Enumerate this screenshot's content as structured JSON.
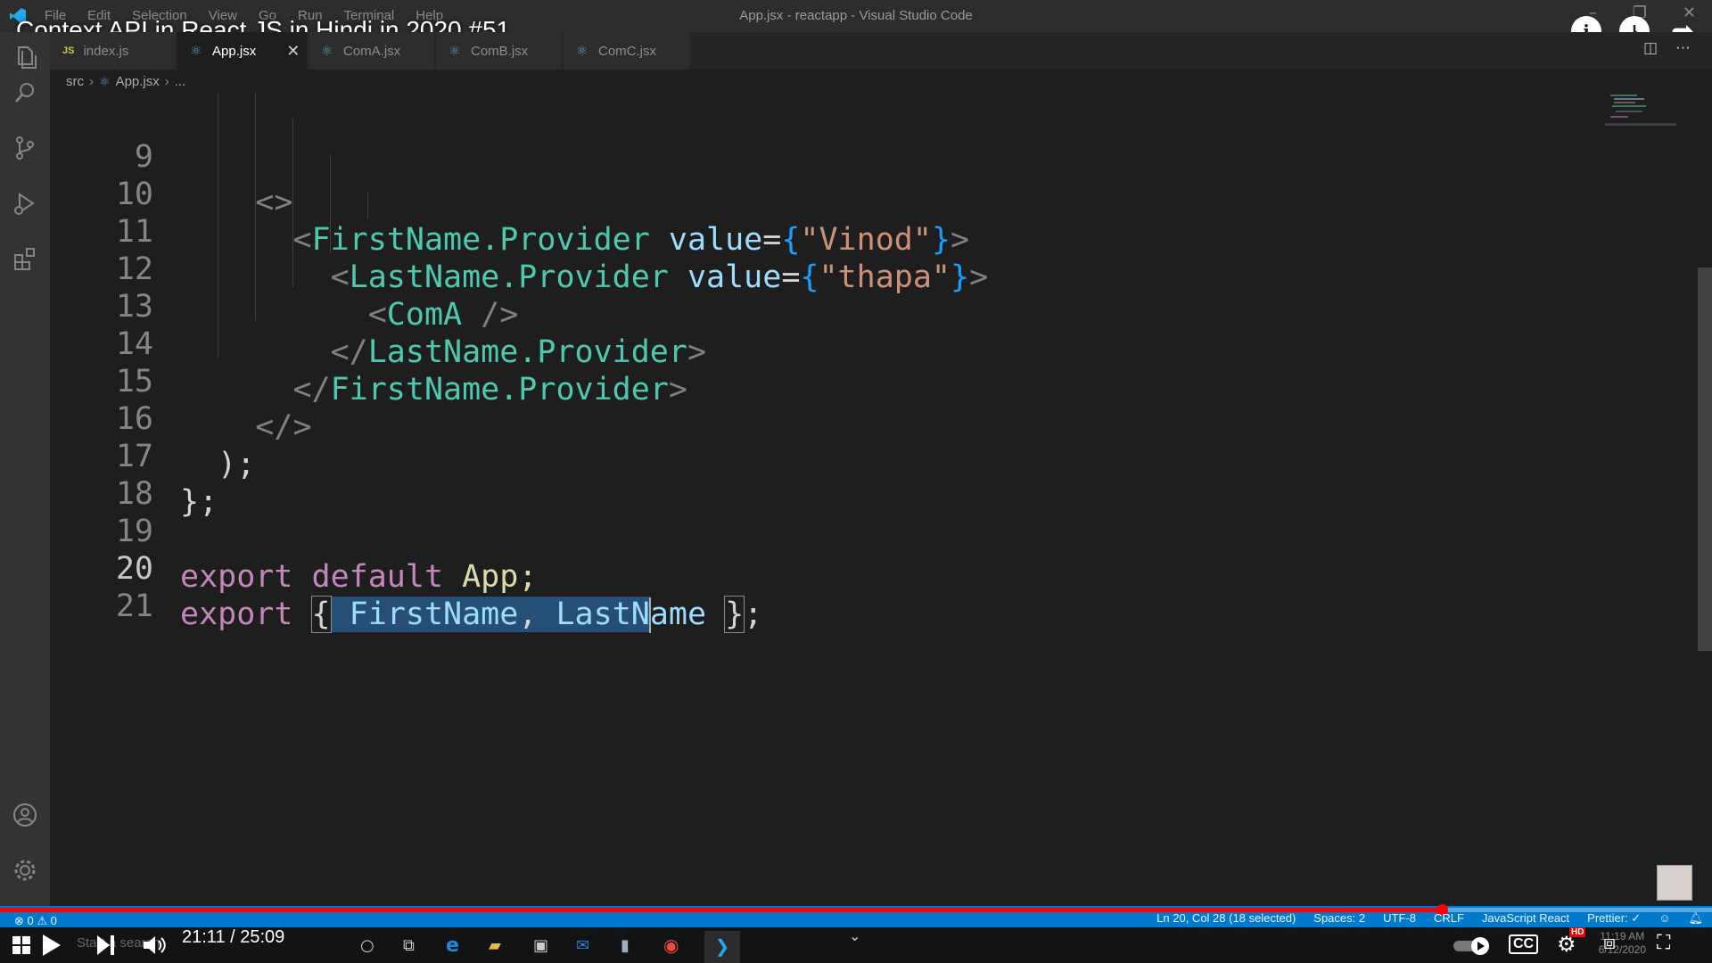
{
  "window": {
    "title": "App.jsx - reactapp - Visual Studio Code",
    "menu": [
      "File",
      "Edit",
      "Selection",
      "View",
      "Go",
      "Run",
      "Terminal",
      "Help"
    ]
  },
  "video": {
    "title": "Context API in React JS in Hindi in 2020 #51",
    "time": "21:11 / 25:09",
    "progress": 0.842,
    "quality_badge": "HD"
  },
  "tabs": [
    {
      "label": "index.js",
      "icon": "JS",
      "active": false
    },
    {
      "label": "App.jsx",
      "icon": "react-icon",
      "active": true
    },
    {
      "label": "ComA.jsx",
      "icon": "react-icon",
      "active": false
    },
    {
      "label": "ComB.jsx",
      "icon": "react-icon",
      "active": false
    },
    {
      "label": "ComC.jsx",
      "icon": "react-icon",
      "active": false
    }
  ],
  "breadcrumb": {
    "folder": "src",
    "file": "App.jsx",
    "more": "..."
  },
  "code": {
    "lines": [
      {
        "num": "9",
        "text": "      <>"
      },
      {
        "num": "10",
        "text": "        <FirstName.Provider value={\"Vinod\"}>"
      },
      {
        "num": "11",
        "text": "          <LastName.Provider value={\"thapa\"}>"
      },
      {
        "num": "12",
        "text": "            <ComA />"
      },
      {
        "num": "13",
        "text": "          </LastName.Provider>"
      },
      {
        "num": "14",
        "text": "        </FirstName.Provider>"
      },
      {
        "num": "15",
        "text": "      </>"
      },
      {
        "num": "16",
        "text": "    );"
      },
      {
        "num": "17",
        "text": "};"
      },
      {
        "num": "18",
        "text": ""
      },
      {
        "num": "19",
        "text": "export default App;"
      },
      {
        "num": "20",
        "text": "export { FirstName, LastName };"
      },
      {
        "num": "21",
        "text": ""
      }
    ],
    "tokens": {
      "open_frag": "<>",
      "close_frag": "</>",
      "first_provider": "FirstName.Provider",
      "last_provider": "LastName.Provider",
      "value_attr": "value",
      "vinod": "\"Vinod\"",
      "thapa": "\"thapa\"",
      "coma": "ComA",
      "paren_close": ");",
      "brace_close": "};",
      "export": "export",
      "default": "default",
      "app": "App;",
      "firstname": "FirstName",
      "lastname_a": "LastN",
      "lastname_b": "ame",
      "comma": ",",
      "semicolon": ";"
    }
  },
  "status": {
    "errors": "0",
    "warnings": "0",
    "position": "Ln 20, Col 28 (18 selected)",
    "spaces": "Spaces: 2",
    "encoding": "UTF-8",
    "eol": "CRLF",
    "language": "JavaScript React",
    "prettier": "Prettier: ✓"
  },
  "taskbar": {
    "search_placeholder": "Start a search",
    "clock_time": "11:19 AM",
    "clock_date": "6/12/2020"
  },
  "colors": {
    "accent": "#007acc",
    "progress": "#ff0000",
    "selection": "#264f78"
  }
}
